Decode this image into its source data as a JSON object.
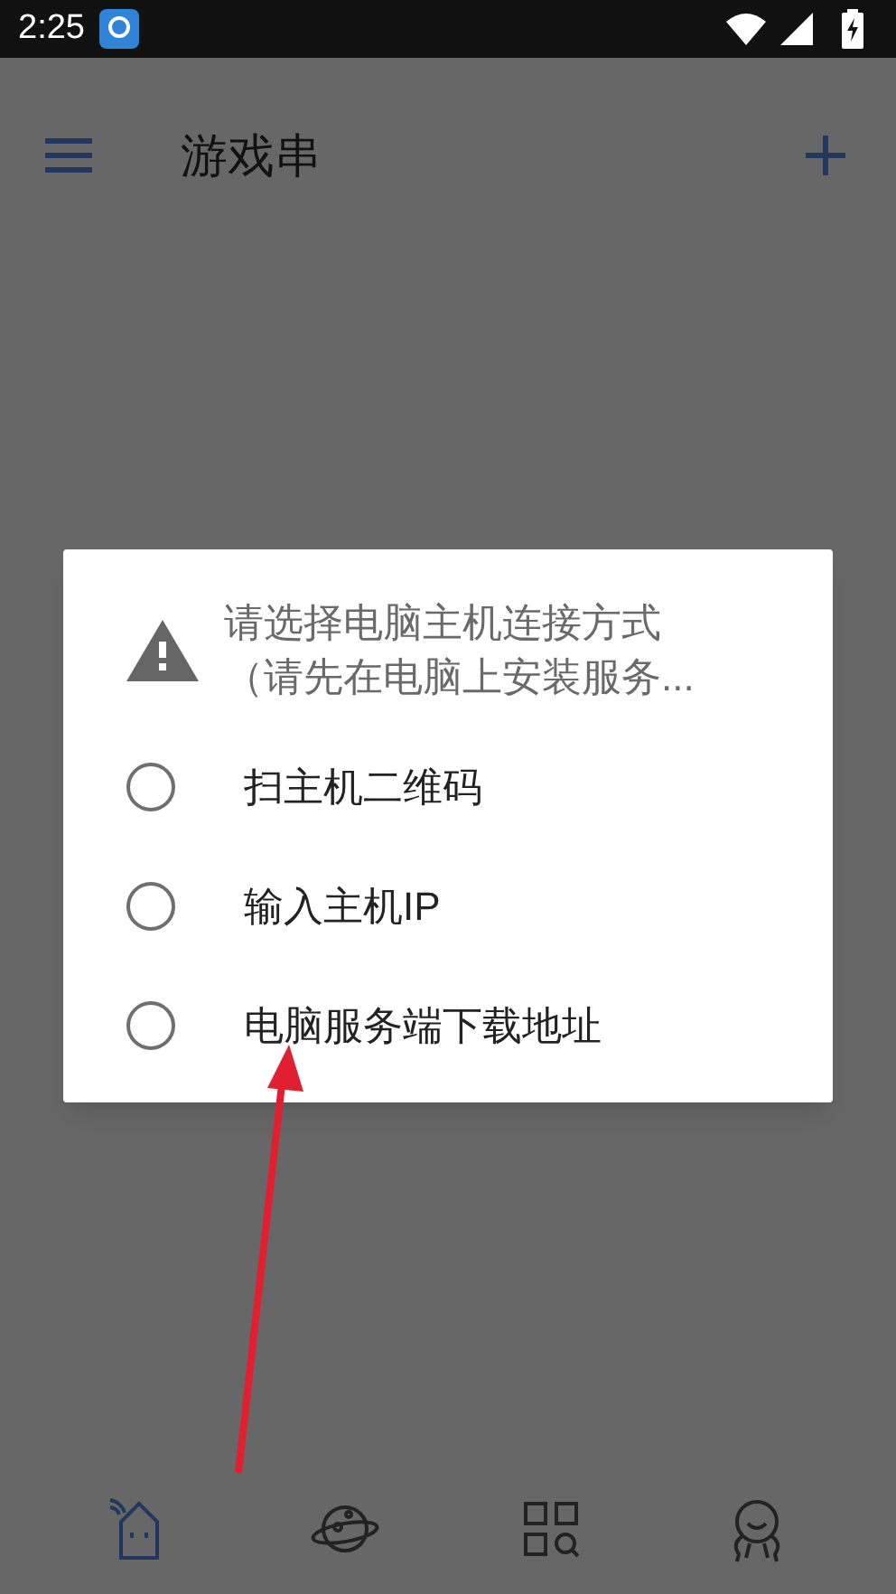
{
  "status_bar": {
    "time": "2:25"
  },
  "app_bar": {
    "title": "游戏串"
  },
  "dialog": {
    "title_lines": [
      "请选择电脑主机连接方式",
      "（请先在电脑上安装服务..."
    ],
    "options": [
      {
        "label": "扫主机二维码",
        "selected": false
      },
      {
        "label": "输入主机IP",
        "selected": false
      },
      {
        "label": "电脑服务端下载地址",
        "selected": false
      }
    ]
  },
  "bottom_nav": [
    {
      "kind": "home",
      "selected": true
    },
    {
      "kind": "planet",
      "selected": false
    },
    {
      "kind": "apps",
      "selected": false
    },
    {
      "kind": "profile",
      "selected": false
    }
  ]
}
